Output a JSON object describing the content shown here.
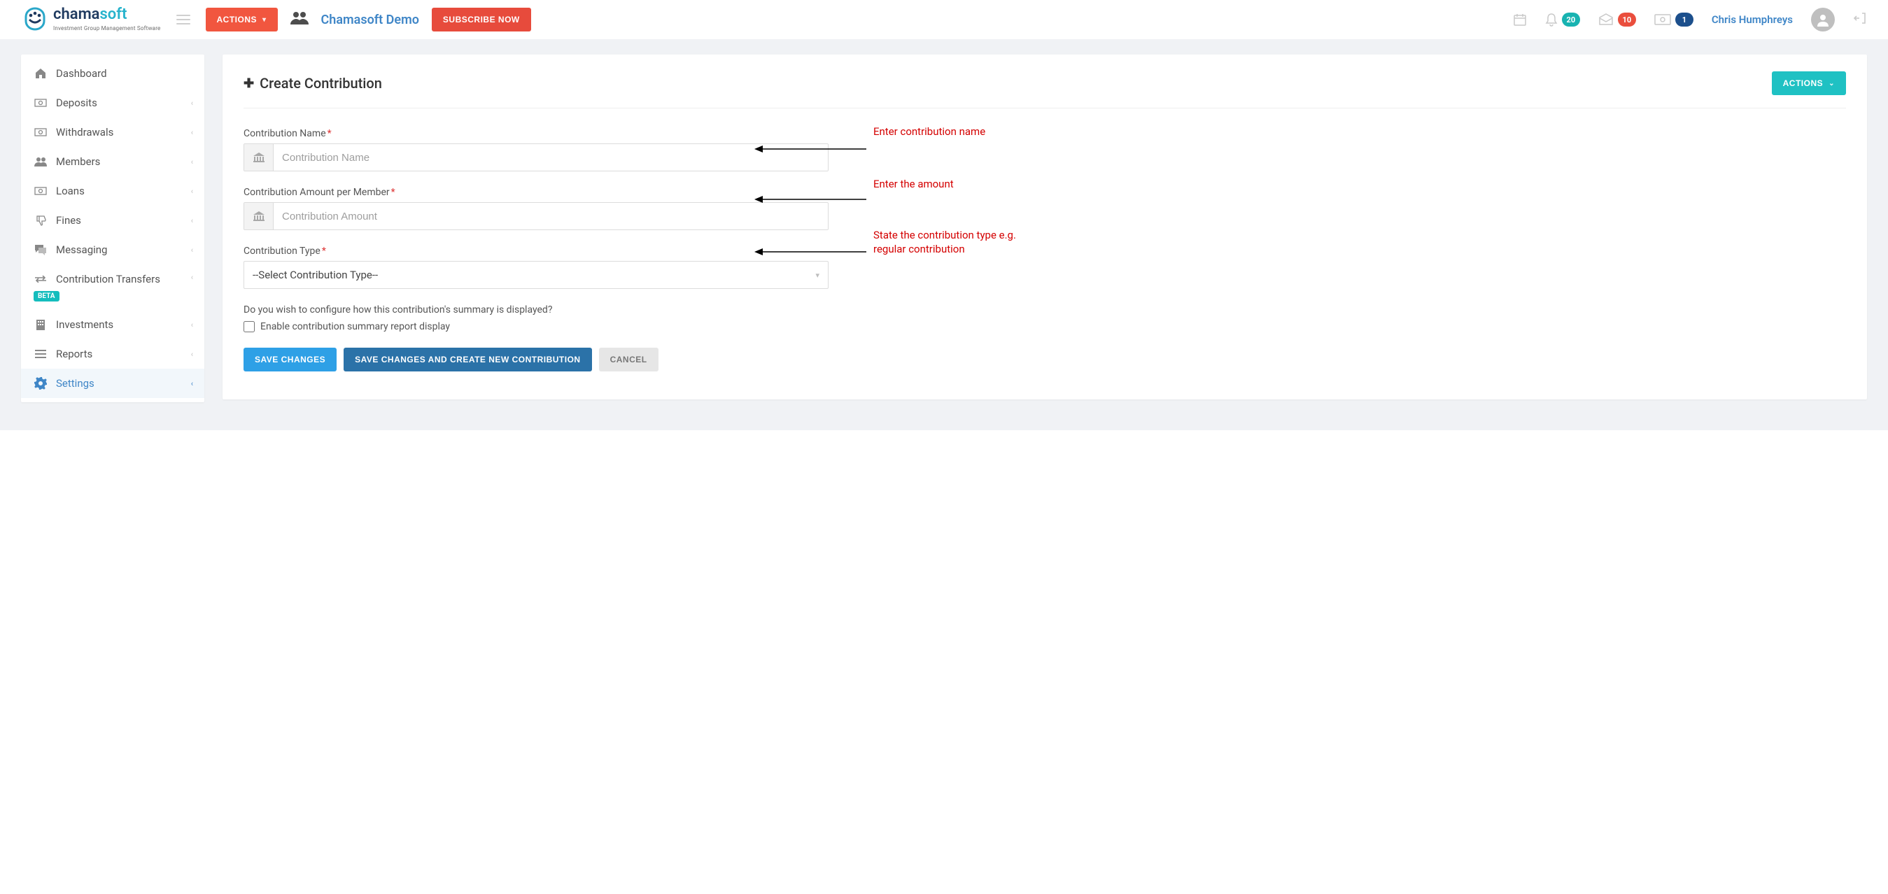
{
  "header": {
    "brand_primary": "chama",
    "brand_secondary": "soft",
    "brand_tagline": "Investment Group Management Software",
    "actions_button": "Actions",
    "group_name": "Chamasoft Demo",
    "subscribe_button": "Subscribe Now",
    "notif_count": "20",
    "mail_count": "10",
    "wallet_count": "1",
    "username": "Chris Humphreys"
  },
  "sidebar": {
    "items": [
      {
        "label": "Dashboard"
      },
      {
        "label": "Deposits"
      },
      {
        "label": "Withdrawals"
      },
      {
        "label": "Members"
      },
      {
        "label": "Loans"
      },
      {
        "label": "Fines"
      },
      {
        "label": "Messaging"
      },
      {
        "label": "Contribution Transfers",
        "badge": "BETA"
      },
      {
        "label": "Investments"
      },
      {
        "label": "Reports"
      },
      {
        "label": "Settings"
      }
    ]
  },
  "panel": {
    "title": "Create Contribution",
    "actions_button": "Actions"
  },
  "form": {
    "name_label": "Contribution Name",
    "name_placeholder": "Contribution Name",
    "amount_label": "Contribution Amount per Member",
    "amount_placeholder": "Contribution Amount",
    "type_label": "Contribution Type",
    "type_selected": "--Select Contribution Type--",
    "question": "Do you wish to configure how this contribution's summary is displayed?",
    "checkbox_label": "Enable contribution summary report display",
    "save": "Save Changes",
    "save_new": "Save Changes and Create New Contribution",
    "cancel": "Cancel"
  },
  "annotations": {
    "a1": "Enter contribution name",
    "a2": "Enter the amount",
    "a3": "State the contribution type e.g. regular contribution"
  }
}
